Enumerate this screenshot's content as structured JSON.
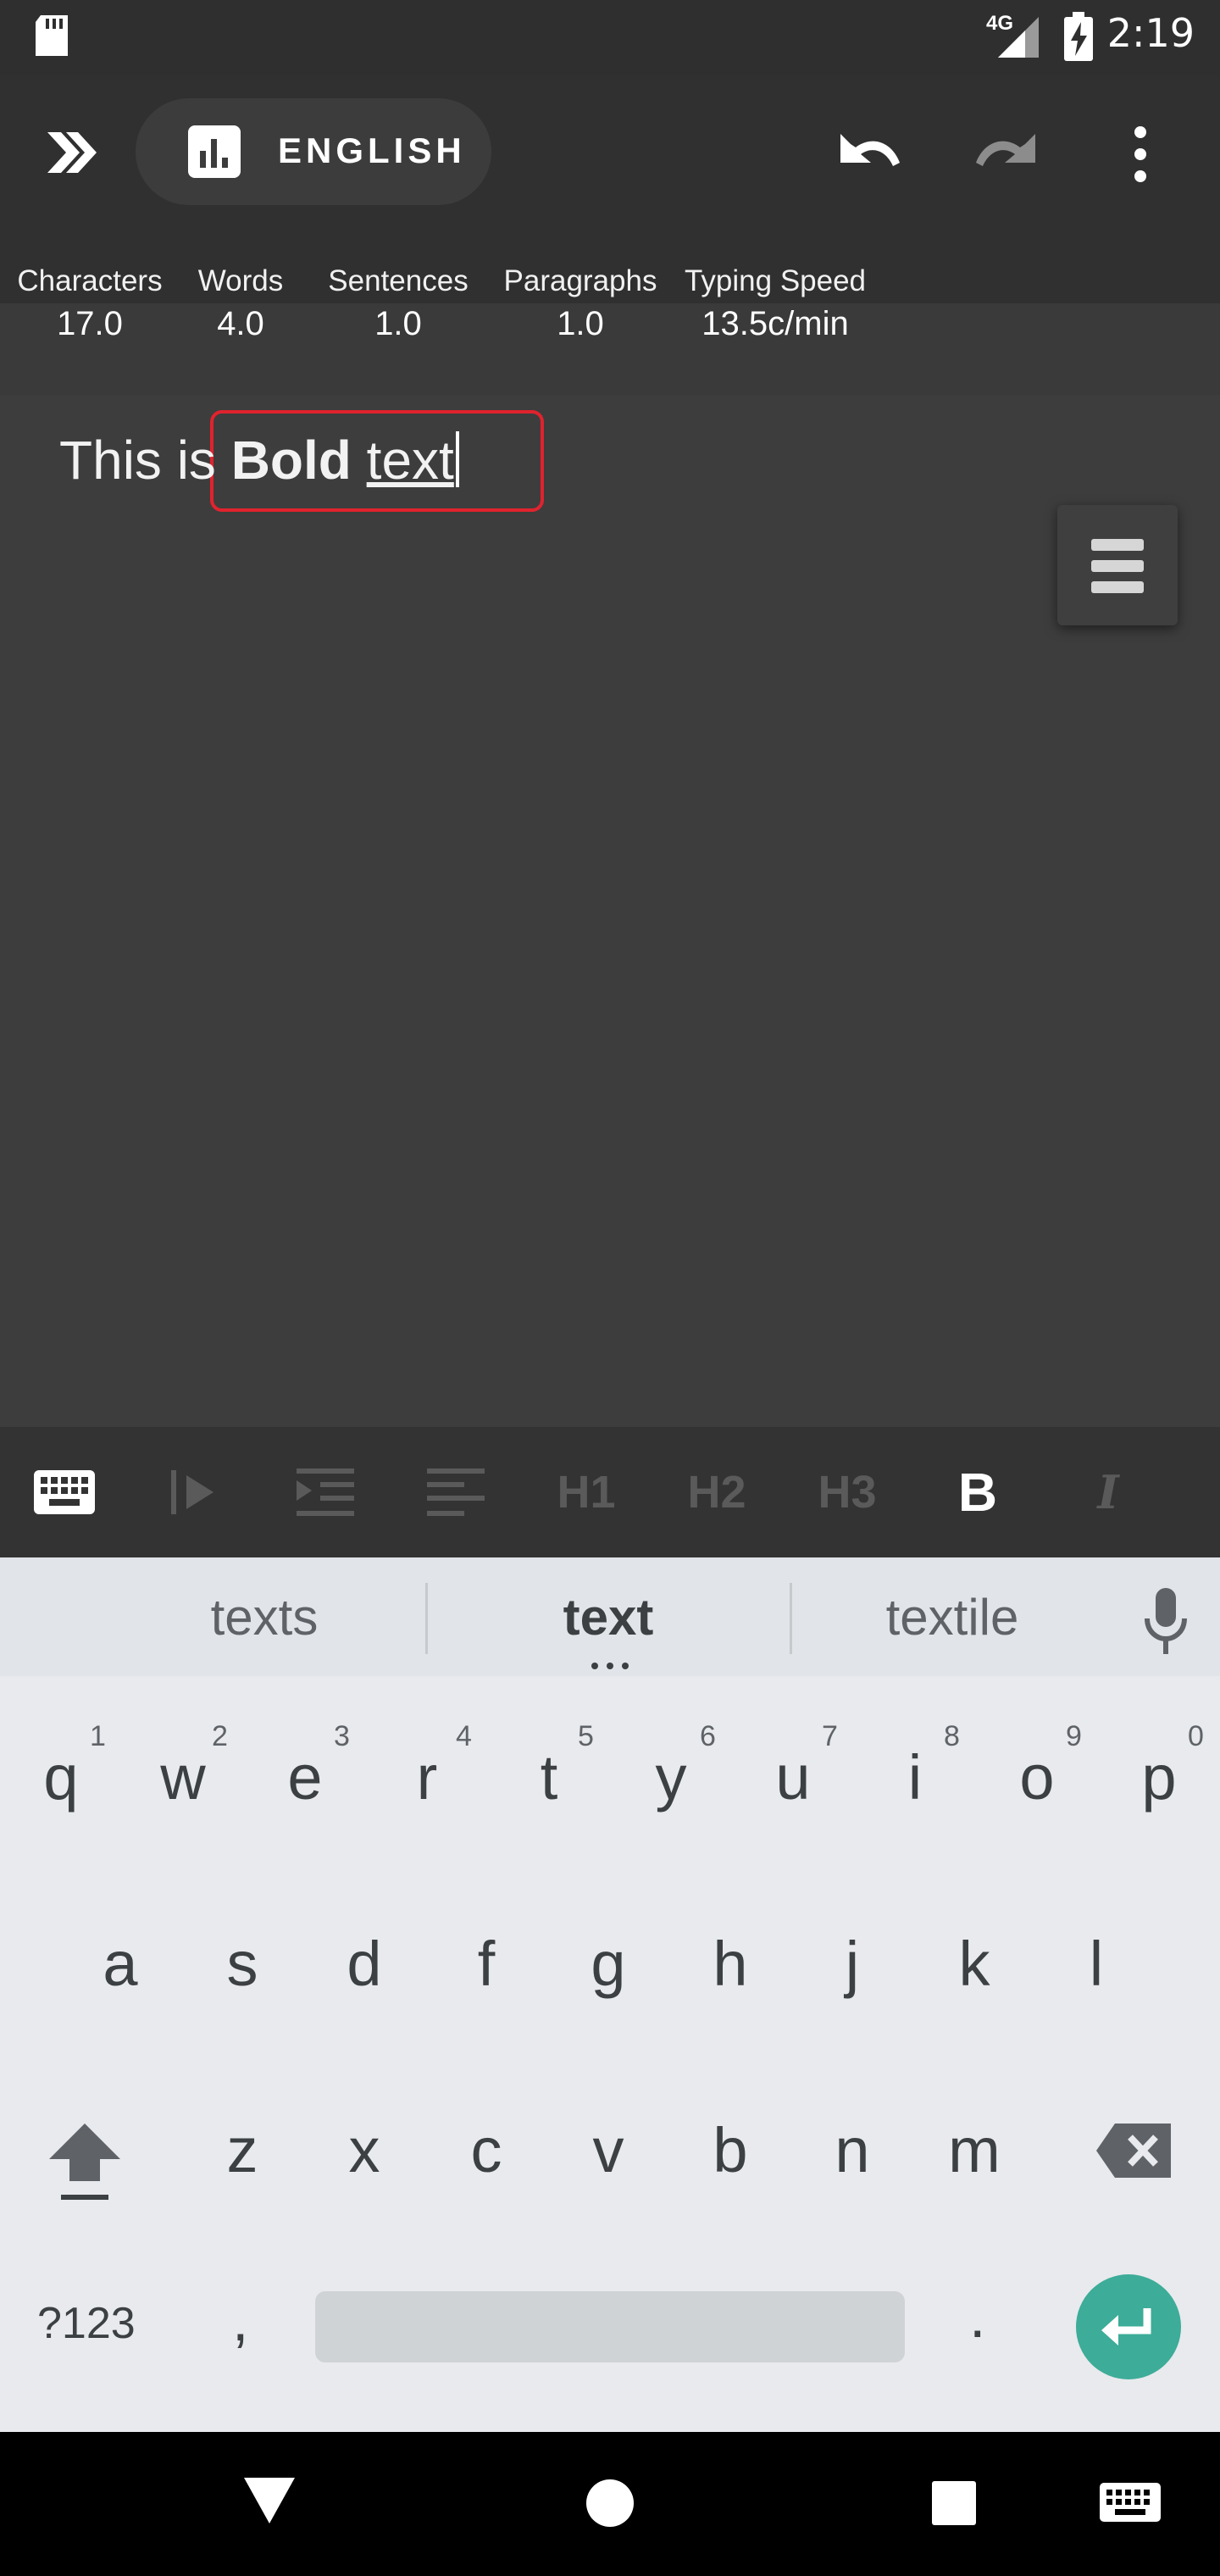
{
  "status_bar": {
    "time": "2:19",
    "network": "4G"
  },
  "app_bar": {
    "language": "ENGLISH",
    "icons": [
      "expand-double-chevron-icon",
      "bar-chart-icon",
      "undo-icon",
      "redo-icon",
      "more-vert-icon"
    ]
  },
  "stats": [
    {
      "label": "Characters",
      "value": "17.0"
    },
    {
      "label": "Words",
      "value": "4.0"
    },
    {
      "label": "Sentences",
      "value": "1.0"
    },
    {
      "label": "Paragraphs",
      "value": "1.0"
    },
    {
      "label": "Typing Speed",
      "value": "13.5c/min"
    }
  ],
  "editor": {
    "plain": "This is ",
    "bold": "Bold",
    "space": " ",
    "underlined": "text"
  },
  "format_toolbar": {
    "h1": "H1",
    "h2": "H2",
    "h3": "H3",
    "bold": "B",
    "italic": "I"
  },
  "keyboard": {
    "suggestions": [
      "texts",
      "text",
      "textile"
    ],
    "row1": [
      "q",
      "w",
      "e",
      "r",
      "t",
      "y",
      "u",
      "i",
      "o",
      "p"
    ],
    "row1_hints": [
      "1",
      "2",
      "3",
      "4",
      "5",
      "6",
      "7",
      "8",
      "9",
      "0"
    ],
    "row2": [
      "a",
      "s",
      "d",
      "f",
      "g",
      "h",
      "j",
      "k",
      "l"
    ],
    "row3": [
      "z",
      "x",
      "c",
      "v",
      "b",
      "n",
      "m"
    ],
    "symbols": "?123",
    "comma": ",",
    "period": "."
  },
  "colors": {
    "highlight_box": "#e0232e",
    "enter_key": "#3dac98",
    "active_bold": "#ffffff"
  }
}
